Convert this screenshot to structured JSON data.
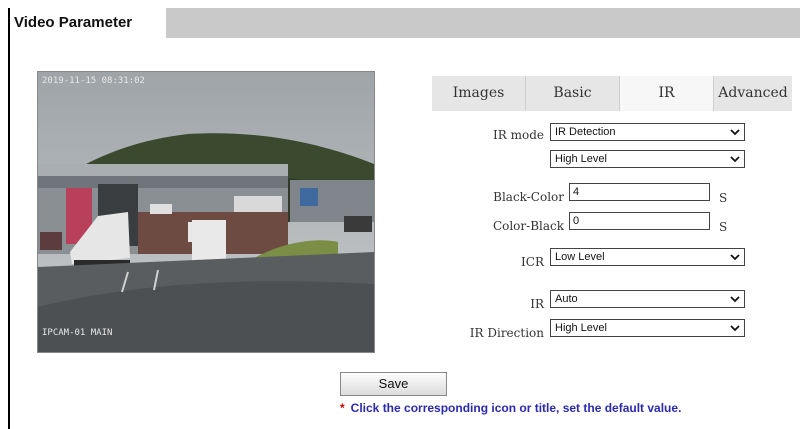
{
  "header": {
    "title": "Video Parameter"
  },
  "preview": {
    "timestamp": "2019-11-15 08:31:02",
    "channel_tag": "IPCAM-01  MAIN"
  },
  "tabs": [
    {
      "label": "Images"
    },
    {
      "label": "Basic"
    },
    {
      "label": "IR",
      "active": true
    },
    {
      "label": "Advanced"
    }
  ],
  "form": {
    "ir_mode": {
      "label": "IR mode",
      "value": "IR Detection",
      "level_value": "High Level"
    },
    "black_color": {
      "label": "Black-Color",
      "value": "4",
      "unit": "S"
    },
    "color_black": {
      "label": "Color-Black",
      "value": "0",
      "unit": "S"
    },
    "icr": {
      "label": "ICR",
      "value": "Low Level"
    },
    "ir": {
      "label": "IR",
      "value": "Auto"
    },
    "ir_direction": {
      "label": "IR Direction",
      "value": "High Level"
    }
  },
  "actions": {
    "save_label": "Save"
  },
  "note": {
    "marker": "*",
    "text": "Click the corresponding icon or title, set the default value."
  },
  "colors": {
    "header_bar": "#c9c9c9",
    "tab_bg": "#e6e6e6",
    "note_text": "#2a2ab0",
    "note_star": "#d00000"
  }
}
